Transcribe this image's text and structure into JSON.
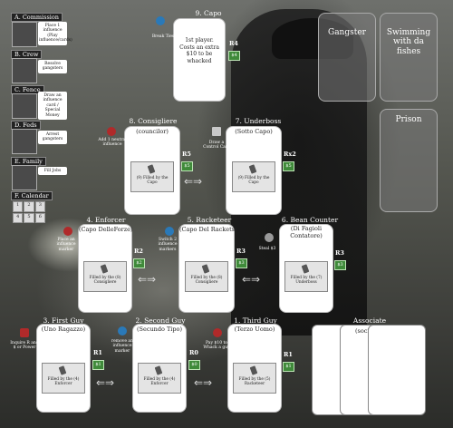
{
  "sidebar": [
    {
      "label": "A. Commission",
      "desc": "Place 1 influence (Play influence/cards)"
    },
    {
      "label": "B. Crew",
      "desc": "Resolve gangsters"
    },
    {
      "label": "C. Fence",
      "desc": "Draw an influence card / Special Money"
    },
    {
      "label": "D. Feds",
      "desc": "Arrest gangsters"
    },
    {
      "label": "E. Family",
      "desc": "Fill Jobs"
    },
    {
      "label": "F. Calendar",
      "desc": ""
    }
  ],
  "calendar_cells": [
    "1",
    "2",
    "3",
    "4",
    "5",
    "6"
  ],
  "positions": {
    "capo": {
      "title": "9. Capo",
      "rank": "R4",
      "money": "$4",
      "text": "1st player. Costs an extra $10 to be whacked",
      "ability": "Break Ties"
    },
    "consigliere": {
      "title": "8. Consigliere",
      "subtitle": "(councilor)",
      "rank": "R5",
      "money": "$5",
      "slot": "(9) Filled by the Capo",
      "ability": "Add 1 neutral influence"
    },
    "underboss": {
      "title": "7. Underboss",
      "subtitle": "(Sotto Capo)",
      "rank": "Rx2",
      "money": "$5",
      "slot": "(9) Filled by the Capo",
      "ability": "Draw a Control Card"
    },
    "enforcer": {
      "title": "4. Enforcer",
      "subtitle": "(Capo DelleForze)",
      "rank": "R2",
      "money": "$2",
      "slot": "Filled by the (8) Consigliere",
      "ability": "Place an influence marker"
    },
    "racketeer": {
      "title": "5. Racketeer",
      "subtitle": "(Capo Del Rackets)",
      "rank": "R3",
      "money": "$3",
      "slot": "Filled by the (8) Consigliere",
      "ability": "Switch 2 influence markers"
    },
    "bean_counter": {
      "title": "6. Bean Counter",
      "subtitle": "(Di Fagioli Contatore)",
      "rank": "R3",
      "money": "$3",
      "slot": "Filled by the (7) Underboss",
      "ability": "Steal $3"
    },
    "first_guy": {
      "title": "3. First Guy",
      "subtitle": "(Uno Ragazzo)",
      "rank": "R1",
      "money": "$1",
      "slot": "Filled by the (4) Enforcer",
      "ability": "Inquire R and $ or Power"
    },
    "second_guy": {
      "title": "2. Second Guy",
      "subtitle": "(Secundo Tipo)",
      "rank": "R0",
      "money": "$0",
      "slot": "Filled by the (4) Enforcer",
      "ability": "remove an influence marker"
    },
    "third_guy": {
      "title": "1. Third Guy",
      "subtitle": "(Terzo Uomo)",
      "rank": "R1",
      "money": "$1",
      "slot": "Filled by the (5) Racketeer",
      "ability": "Pay $10 to Whack a guy"
    },
    "associate": {
      "title": "Associate",
      "subtitle": "(soci)"
    }
  },
  "panels": {
    "gangster": "Gangster",
    "swimming": "Swimming with da fishes",
    "prison": "Prison"
  },
  "colors": {
    "money": "#3f8a3a",
    "card": "#ffffff",
    "panel": "#7a7a7a"
  }
}
